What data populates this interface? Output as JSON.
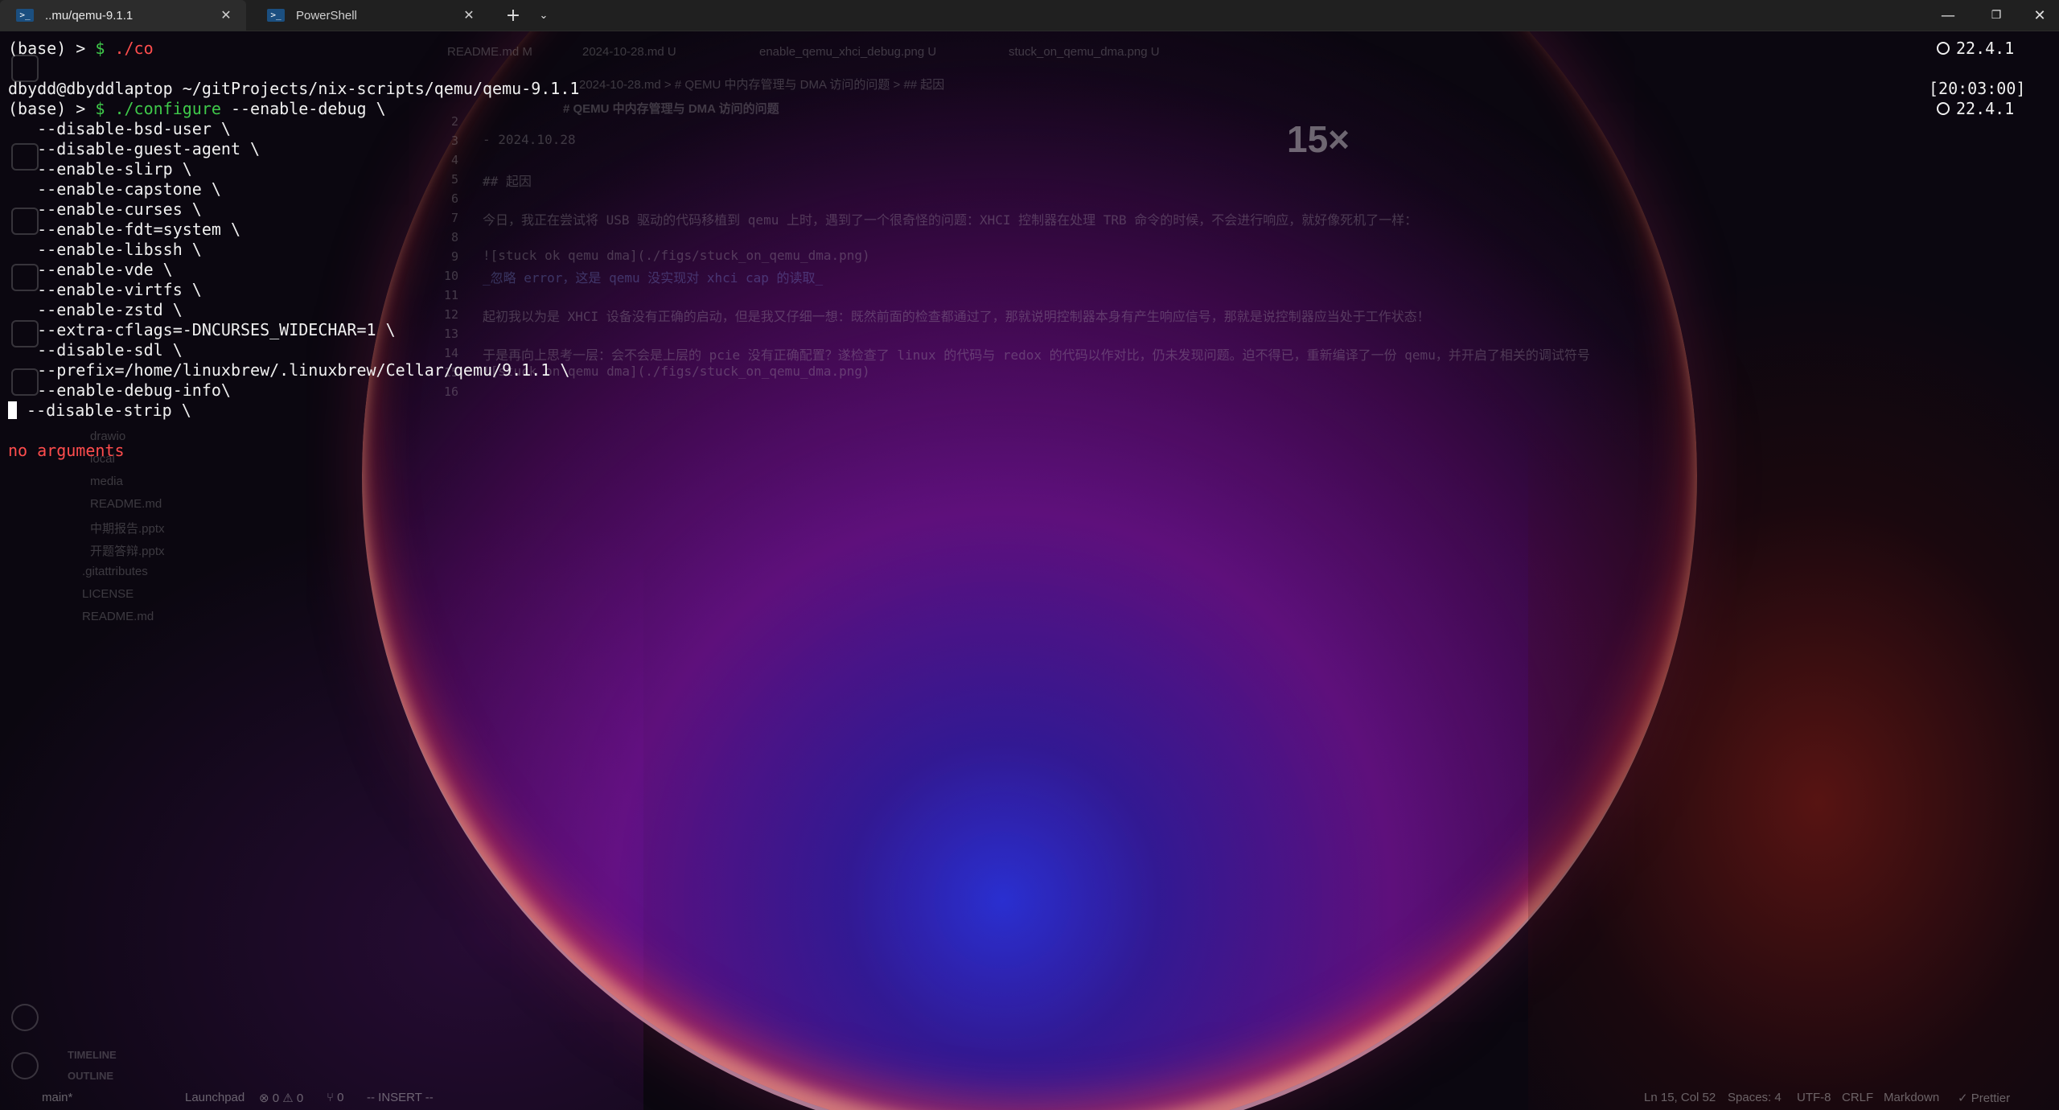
{
  "window": {
    "tabs": [
      {
        "label": "..mu/qemu-9.1.1",
        "active": true
      },
      {
        "label": "PowerShell",
        "active": false
      }
    ],
    "new_tab_label": "+",
    "tab_menu_label": "⌄",
    "minimize": "—",
    "maximize": "❐",
    "close": "✕"
  },
  "terminal": {
    "line1": {
      "prefix": "(base) > ",
      "prompt": "$",
      "cmd": " ./co"
    },
    "cwd": "dbydd@dbyddlaptop ~/gitProjects/nix-scripts/qemu/qemu-9.1.1",
    "line3": {
      "prefix": "(base) > ",
      "prompt": "$",
      "cmd": " ./configure",
      "args": " --enable-debug \\"
    },
    "config_lines": [
      "   --disable-bsd-user \\",
      "   --disable-guest-agent \\",
      "   --enable-slirp \\",
      "   --enable-capstone \\",
      "   --enable-curses \\",
      "   --enable-fdt=system \\",
      "   --enable-libssh \\",
      "   --enable-vde \\",
      "   --enable-virtfs \\",
      "   --enable-zstd \\",
      "   --extra-cflags=-DNCURSES_WIDECHAR=1 \\",
      "   --disable-sdl \\",
      "   --prefix=/home/linuxbrew/.linuxbrew/Cellar/qemu/9.1.1 \\",
      "   --enable-debug-info\\"
    ],
    "cursor_line": " --disable-strip \\",
    "error": "no arguments",
    "right_version_1": "22.4.1",
    "right_time": "[20:03:00]",
    "right_version_2": "22.4.1"
  },
  "ghost_editor": {
    "tabs": [
      "README.md M",
      "2024-10-28.md U",
      "enable_qemu_xhci_debug.png U",
      "stuck_on_qemu_dma.png U"
    ],
    "breadcrumb": "2024-10-28.md > # QEMU 中内存管理与 DMA 访问的问题 > ## 起因",
    "heading": "# QEMU 中内存管理与 DMA 访问的问题",
    "zoom": "15×",
    "lines": [
      {
        "n": "2",
        "text": ""
      },
      {
        "n": "3",
        "text": "- 2024.10.28"
      },
      {
        "n": "4",
        "text": ""
      },
      {
        "n": "5",
        "text": "## 起因"
      },
      {
        "n": "6",
        "text": ""
      },
      {
        "n": "7",
        "text": "今日，我正在尝试将 USB 驱动的代码移植到 qemu 上时，遇到了一个很奇怪的问题：XHCI 控制器在处理 TRB 命令的时候，不会进行响应，就好像死机了一样："
      },
      {
        "n": "8",
        "text": ""
      },
      {
        "n": "9",
        "text": "![stuck ok qemu dma](./figs/stuck_on_qemu_dma.png)"
      },
      {
        "n": "10",
        "text": "_忽略 error，这是 qemu 没实现对 xhci cap 的读取_"
      },
      {
        "n": "11",
        "text": ""
      },
      {
        "n": "12",
        "text": "起初我以为是 XHCI 设备没有正确的启动，但是我又仔细一想：既然前面的检查都通过了，那就说明控制器本身有产生响应信号，那就是说控制器应当处于工作状态！"
      },
      {
        "n": "13",
        "text": ""
      },
      {
        "n": "14",
        "text": "于是再向上思考一层：会不会是上层的 pcie 没有正确配置？遂检查了 linux 的代码与 redox 的代码以作对比，仍未发现问题。迫不得已，重新编译了一份 qemu，并开启了相关的调试符号"
      },
      {
        "n": "15",
        "text": "![stuck on qemu dma](./figs/stuck_on_qemu_dma.png)"
      },
      {
        "n": "16",
        "text": ""
      }
    ],
    "tree": [
      "drawio",
      "local",
      "media",
      "README.md",
      "中期报告.pptx",
      "开题答辩.pptx",
      ".gitattributes",
      "LICENSE",
      "README.md"
    ],
    "sections": [
      "TIMELINE",
      "OUTLINE"
    ],
    "status": {
      "branch": "main*",
      "launchpad": "Launchpad",
      "problems": "⊗ 0 ⚠ 0",
      "ports": "⑂ 0",
      "mode": "-- INSERT --",
      "position": "Ln 15, Col 52",
      "spaces": "Spaces: 4",
      "encoding": "UTF-8",
      "eol": "CRLF",
      "language": "Markdown",
      "formatter": "✓ Prettier"
    }
  },
  "colors": {
    "prompt": "#3fc94a",
    "error": "#ff4d4d",
    "path": "#3fbfe8"
  }
}
